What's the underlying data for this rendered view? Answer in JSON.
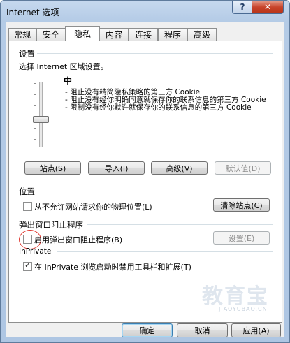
{
  "window": {
    "title": "Internet 选项"
  },
  "title_buttons": {
    "help": "?",
    "close": "✕"
  },
  "tabs": [
    {
      "label": "常规"
    },
    {
      "label": "安全"
    },
    {
      "label": "隐私"
    },
    {
      "label": "内容"
    },
    {
      "label": "连接"
    },
    {
      "label": "程序"
    },
    {
      "label": "高级"
    }
  ],
  "active_tab": "隐私",
  "settings": {
    "group": "设置",
    "prompt": "选择 Internet 区域设置。",
    "level": "中",
    "slider_level_fraction": 0.5,
    "descriptions": [
      "- 阻止没有精简隐私策略的第三方 Cookie",
      "- 阻止没有经你明确同意就保存你的联系信息的第三方 Cookie",
      "- 限制没有经你默许就保存你的联系信息的第三方 Cookie"
    ],
    "buttons": {
      "sites": "站点(S)",
      "import": "导入(I)",
      "advanced": "高级(V)",
      "default": "默认值(D)"
    }
  },
  "location": {
    "group": "位置",
    "checkbox_label": "从不允许网站请求你的物理位置(L)",
    "checked": false,
    "clear_button": "清除站点(C)"
  },
  "popup": {
    "group": "弹出窗口阻止程序",
    "checkbox_label": "启用弹出窗口阻止程序(B)",
    "checked": false,
    "settings_button": "设置(E)"
  },
  "inprivate": {
    "group": "InPrivate",
    "checkbox_label": "在 InPrivate 浏览启动时禁用工具栏和扩展(T)",
    "checked": true
  },
  "footer": {
    "ok": "确定",
    "cancel": "取消",
    "apply": "应用(A)"
  },
  "watermark": {
    "logo_text": "教育宝",
    "url_text": "JIAOYUBAO.CN"
  }
}
